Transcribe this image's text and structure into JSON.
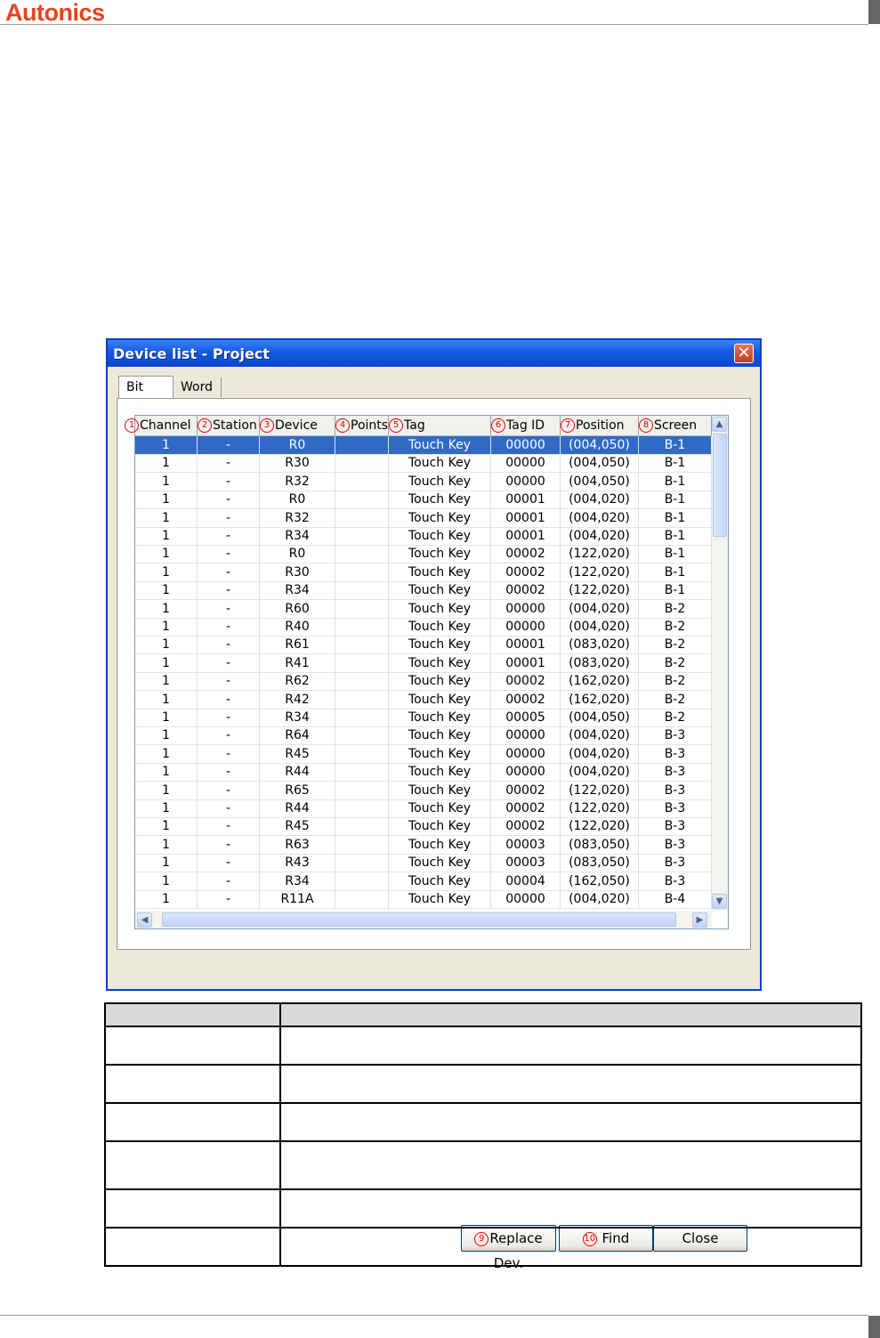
{
  "page": {
    "brand": "Autonics"
  },
  "dialog": {
    "title": "Device list - Project",
    "close_glyph": "✕",
    "tabs": [
      {
        "label": "Bit",
        "active": true
      },
      {
        "label": "Word",
        "active": false
      }
    ],
    "columns": [
      {
        "num": "1",
        "label": "Channel"
      },
      {
        "num": "2",
        "label": "Station"
      },
      {
        "num": "3",
        "label": "Device"
      },
      {
        "num": "4",
        "label": "Points"
      },
      {
        "num": "5",
        "label": "Tag"
      },
      {
        "num": "6",
        "label": "Tag ID"
      },
      {
        "num": "7",
        "label": "Position"
      },
      {
        "num": "8",
        "label": "Screen"
      }
    ],
    "rows": [
      [
        "1",
        "-",
        "R0",
        "",
        "Touch Key",
        "00000",
        "(004,050)",
        "B-1"
      ],
      [
        "1",
        "-",
        "R30",
        "",
        "Touch Key",
        "00000",
        "(004,050)",
        "B-1"
      ],
      [
        "1",
        "-",
        "R32",
        "",
        "Touch Key",
        "00000",
        "(004,050)",
        "B-1"
      ],
      [
        "1",
        "-",
        "R0",
        "",
        "Touch Key",
        "00001",
        "(004,020)",
        "B-1"
      ],
      [
        "1",
        "-",
        "R32",
        "",
        "Touch Key",
        "00001",
        "(004,020)",
        "B-1"
      ],
      [
        "1",
        "-",
        "R34",
        "",
        "Touch Key",
        "00001",
        "(004,020)",
        "B-1"
      ],
      [
        "1",
        "-",
        "R0",
        "",
        "Touch Key",
        "00002",
        "(122,020)",
        "B-1"
      ],
      [
        "1",
        "-",
        "R30",
        "",
        "Touch Key",
        "00002",
        "(122,020)",
        "B-1"
      ],
      [
        "1",
        "-",
        "R34",
        "",
        "Touch Key",
        "00002",
        "(122,020)",
        "B-1"
      ],
      [
        "1",
        "-",
        "R60",
        "",
        "Touch Key",
        "00000",
        "(004,020)",
        "B-2"
      ],
      [
        "1",
        "-",
        "R40",
        "",
        "Touch Key",
        "00000",
        "(004,020)",
        "B-2"
      ],
      [
        "1",
        "-",
        "R61",
        "",
        "Touch Key",
        "00001",
        "(083,020)",
        "B-2"
      ],
      [
        "1",
        "-",
        "R41",
        "",
        "Touch Key",
        "00001",
        "(083,020)",
        "B-2"
      ],
      [
        "1",
        "-",
        "R62",
        "",
        "Touch Key",
        "00002",
        "(162,020)",
        "B-2"
      ],
      [
        "1",
        "-",
        "R42",
        "",
        "Touch Key",
        "00002",
        "(162,020)",
        "B-2"
      ],
      [
        "1",
        "-",
        "R34",
        "",
        "Touch Key",
        "00005",
        "(004,050)",
        "B-2"
      ],
      [
        "1",
        "-",
        "R64",
        "",
        "Touch Key",
        "00000",
        "(004,020)",
        "B-3"
      ],
      [
        "1",
        "-",
        "R45",
        "",
        "Touch Key",
        "00000",
        "(004,020)",
        "B-3"
      ],
      [
        "1",
        "-",
        "R44",
        "",
        "Touch Key",
        "00000",
        "(004,020)",
        "B-3"
      ],
      [
        "1",
        "-",
        "R65",
        "",
        "Touch Key",
        "00002",
        "(122,020)",
        "B-3"
      ],
      [
        "1",
        "-",
        "R44",
        "",
        "Touch Key",
        "00002",
        "(122,020)",
        "B-3"
      ],
      [
        "1",
        "-",
        "R45",
        "",
        "Touch Key",
        "00002",
        "(122,020)",
        "B-3"
      ],
      [
        "1",
        "-",
        "R63",
        "",
        "Touch Key",
        "00003",
        "(083,050)",
        "B-3"
      ],
      [
        "1",
        "-",
        "R43",
        "",
        "Touch Key",
        "00003",
        "(083,050)",
        "B-3"
      ],
      [
        "1",
        "-",
        "R34",
        "",
        "Touch Key",
        "00004",
        "(162,050)",
        "B-3"
      ],
      [
        "1",
        "-",
        "R11A",
        "",
        "Touch Key",
        "00000",
        "(004,020)",
        "B-4"
      ]
    ],
    "selected_row": 0,
    "buttons": {
      "replace": {
        "num": "9",
        "label": "Replace Dev."
      },
      "find": {
        "num": "10",
        "label": "Find"
      },
      "close": {
        "label": "Close"
      }
    }
  },
  "description_table": {
    "rows": 6
  },
  "colors": {
    "brand": "#e8421b",
    "title_bar": "#0a46d2",
    "selection": "#316ac5",
    "marker": "#e00000"
  }
}
